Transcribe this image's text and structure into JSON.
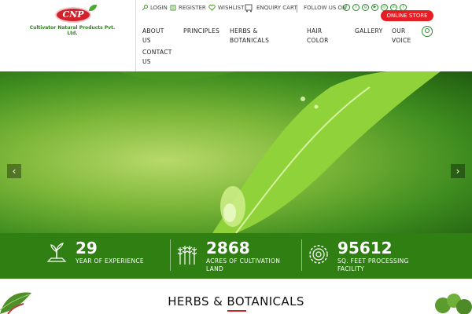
{
  "brand": {
    "logo_text": "CNP",
    "company_name": "Cultivator Natural Products Pvt. Ltd."
  },
  "topbar": {
    "login": "LOGIN",
    "register": "REGISTER",
    "wishlist": "WISHLIST",
    "enquiry_cart": "ENQUIRY CART",
    "follow_us": "FOLLOW US ON",
    "social_icons": [
      "facebook-icon",
      "twitter-icon",
      "google-plus-icon",
      "youtube-icon",
      "instagram-icon",
      "linkedin-icon",
      "rss-icon"
    ],
    "online_store": "ONLINE STORE"
  },
  "nav": {
    "about": [
      "ABOUT",
      "US"
    ],
    "principles": "PRINCIPLES",
    "herbs": [
      "HERBS &",
      "BOTANICALS"
    ],
    "hair": [
      "HAIR",
      "COLOR"
    ],
    "gallery": "GALLERY",
    "voice": [
      "OUR",
      "VOICE"
    ],
    "contact": [
      "CONTACT",
      "US"
    ]
  },
  "hero": {
    "prev": "‹",
    "next": "›"
  },
  "stats": [
    {
      "icon": "plant-icon",
      "number": "29",
      "label": [
        "YEAR OF EXPERIENCE"
      ]
    },
    {
      "icon": "wheat-icon",
      "number": "2868",
      "label": [
        "ACRES OF CULTIVATION",
        "LAND"
      ]
    },
    {
      "icon": "gear-icon",
      "number": "95612",
      "label": [
        "SQ. FEET PROCESSING",
        "FACILITY"
      ]
    }
  ],
  "section": {
    "title": "HERBS & BOTANICALS"
  },
  "colors": {
    "brand_green": "#2f7f13",
    "brand_red": "#e31e24"
  }
}
